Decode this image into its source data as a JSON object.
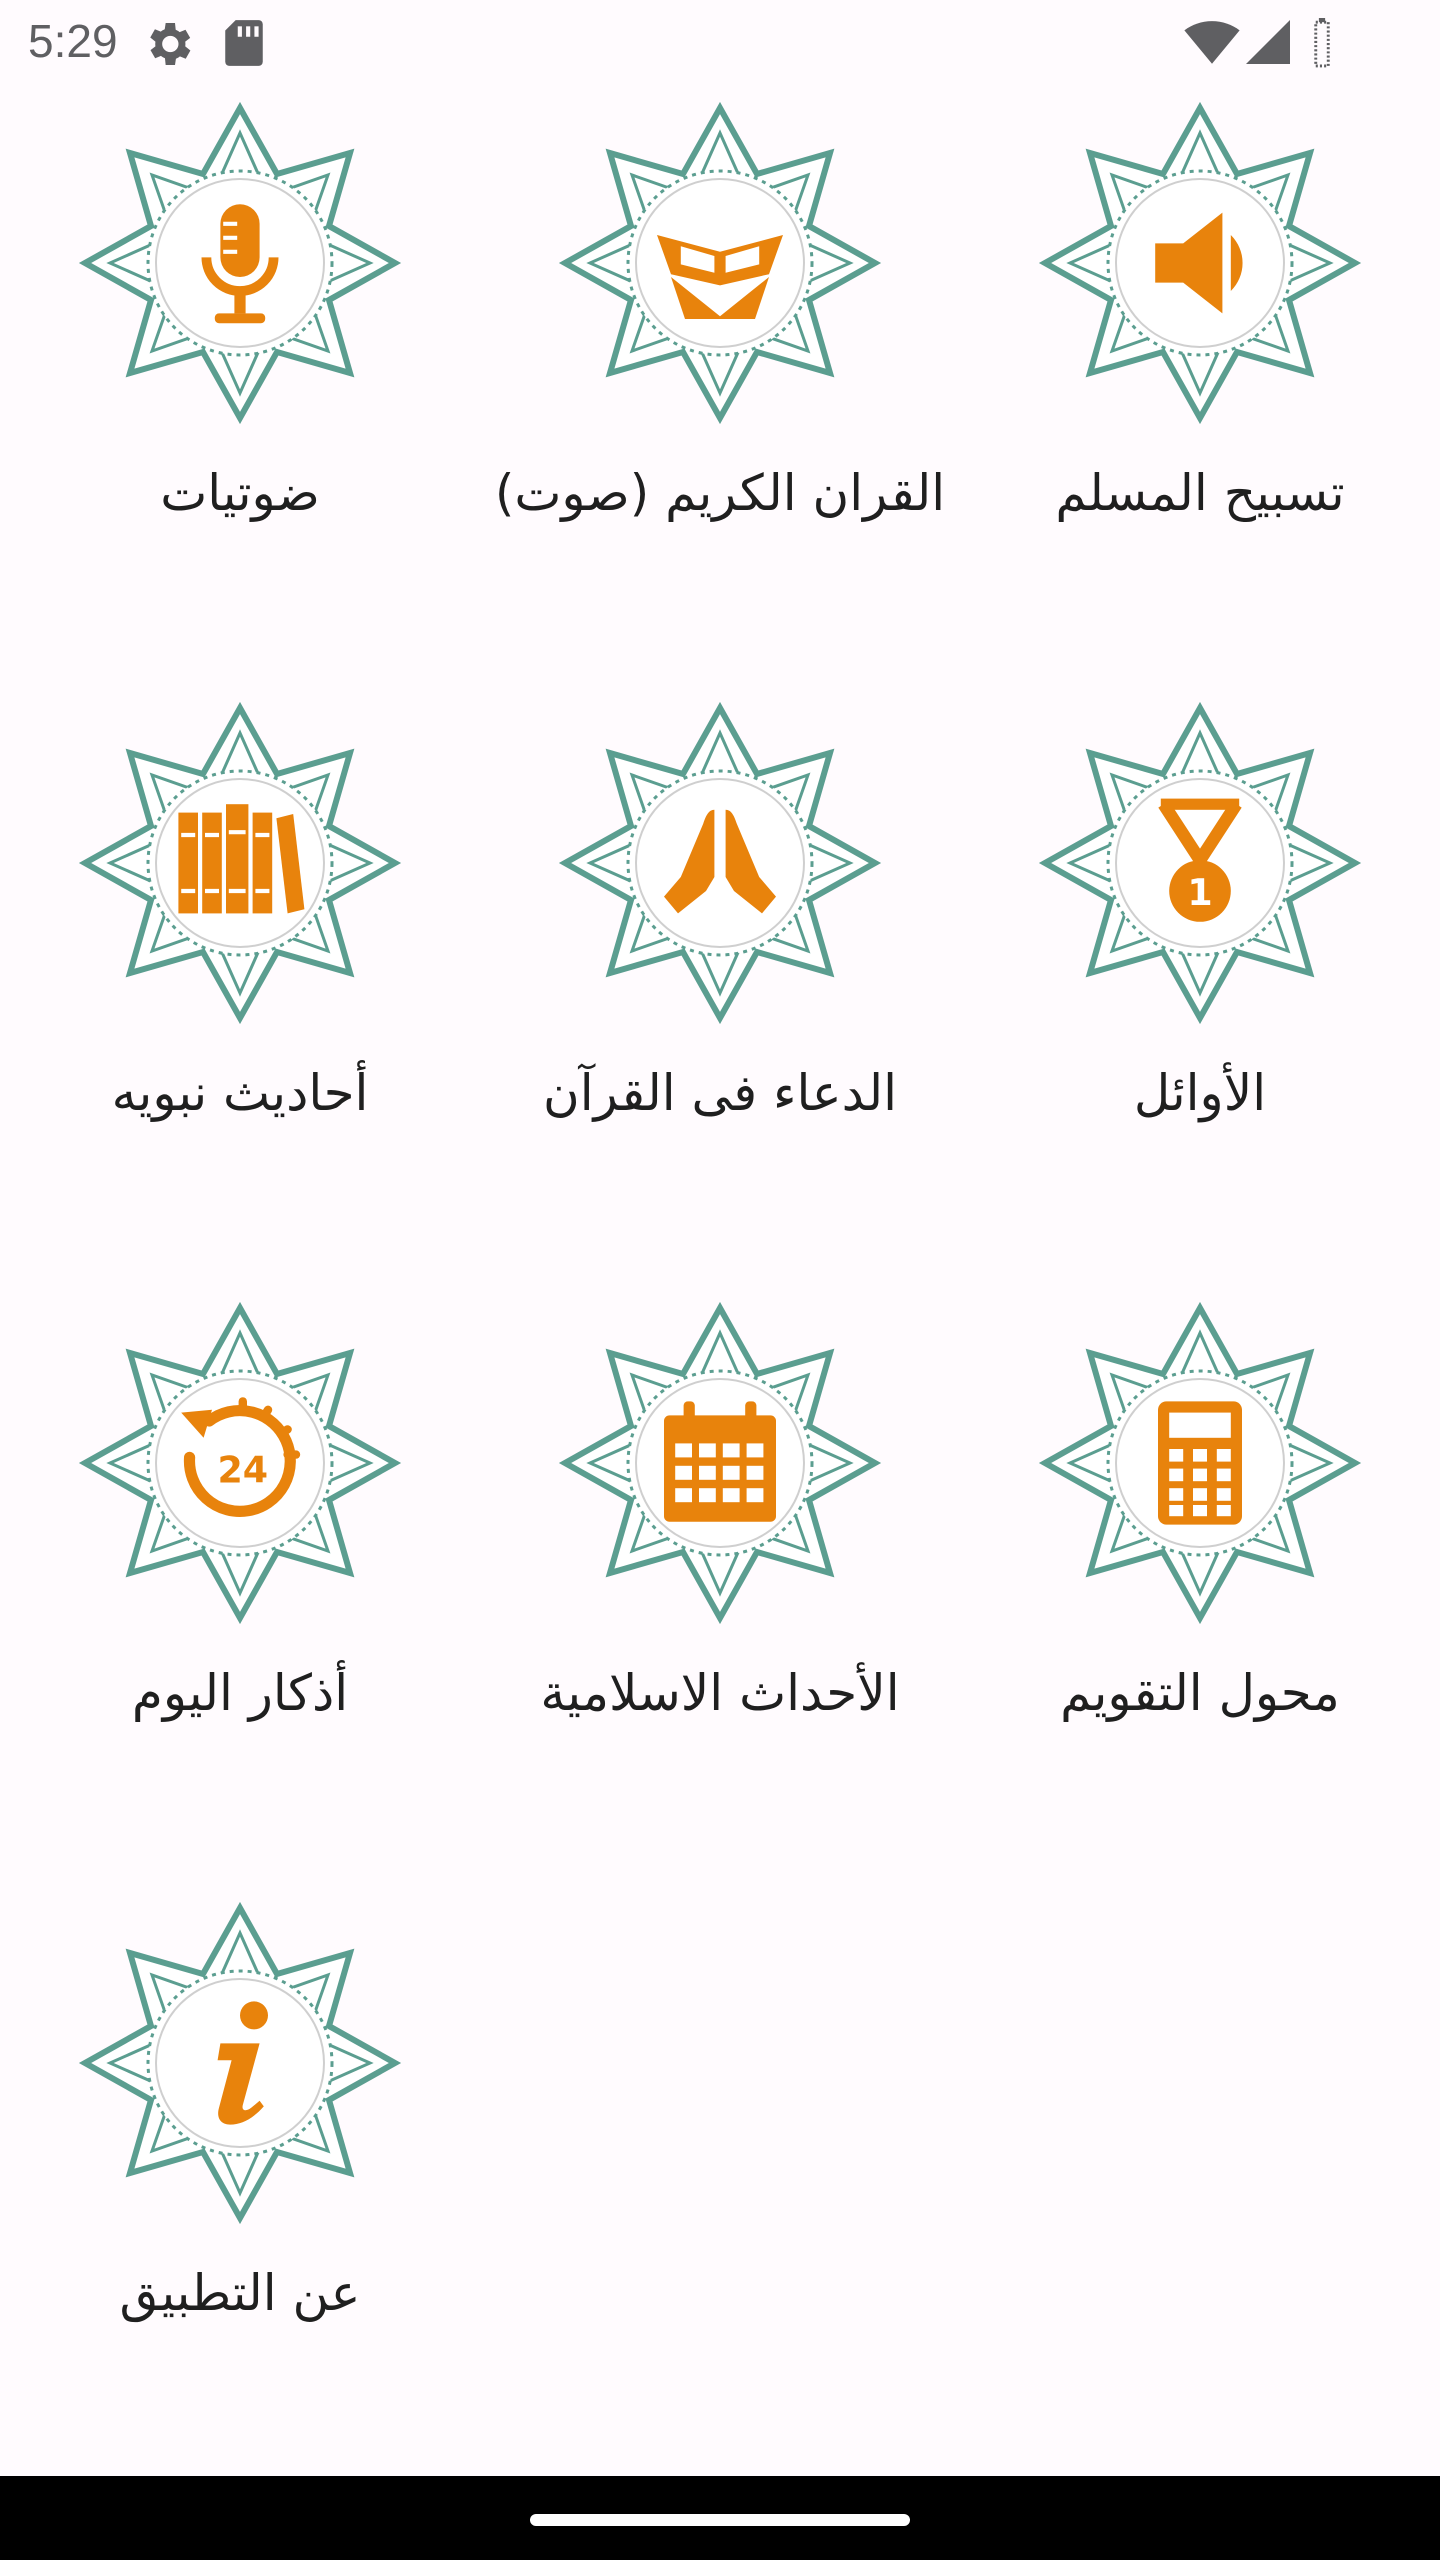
{
  "status_bar": {
    "time": "5:29",
    "icons": [
      "gear-icon",
      "sd-card-icon",
      "wifi-icon",
      "cellular-signal-icon",
      "battery-icon"
    ]
  },
  "colors": {
    "accent": "#e8830c",
    "ornament": "#5b9e90",
    "background": "#fffbfe"
  },
  "grid": {
    "items": [
      {
        "label": "تسبيح المسلم",
        "icon": "speaker-icon"
      },
      {
        "label": "القران الكريم (صوت)",
        "icon": "quran-stand-icon"
      },
      {
        "label": "ضوتيات",
        "icon": "microphone-icon"
      },
      {
        "label": "الأوائل",
        "icon": "medal-icon"
      },
      {
        "label": "الدعاء فى القرآن",
        "icon": "praying-hands-icon"
      },
      {
        "label": "أحاديث نبويه",
        "icon": "books-icon"
      },
      {
        "label": "محول التقويم",
        "icon": "calculator-icon"
      },
      {
        "label": "الأحداث الاسلامية",
        "icon": "calendar-icon"
      },
      {
        "label": "أذكار اليوم",
        "icon": "24-hours-icon"
      },
      {
        "label": "عن التطبيق",
        "icon": "info-icon"
      }
    ]
  }
}
